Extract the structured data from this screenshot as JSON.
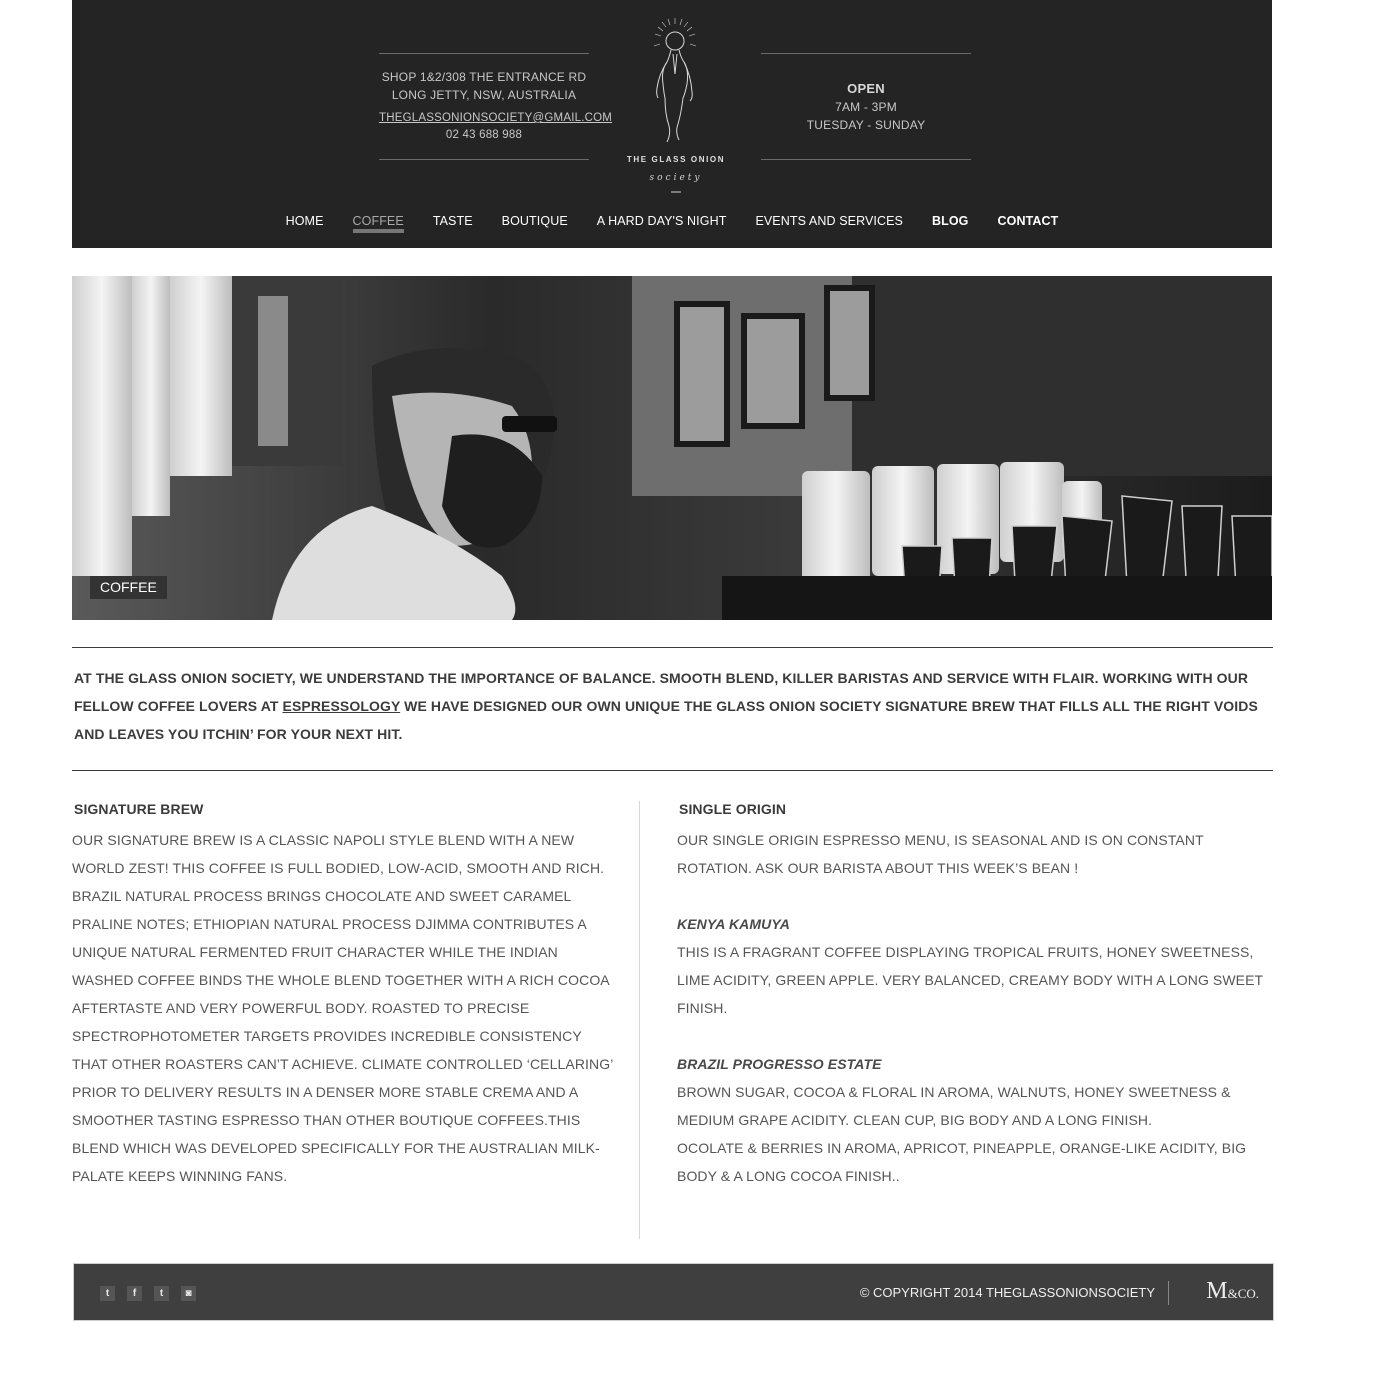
{
  "header": {
    "address_line1": "SHOP 1&2/308 THE ENTRANCE RD",
    "address_line2": "LONG JETTY, NSW, AUSTRALIA",
    "email": "THEGLASSONIONSOCIETY@GMAIL.COM",
    "phone": "02 43 688 988",
    "hours_title": "OPEN",
    "hours_time": "7AM - 3PM",
    "hours_days": "TUESDAY - SUNDAY",
    "logo_line1": "THE GLASS ONION",
    "logo_line2": "society"
  },
  "nav": {
    "items": [
      {
        "label": "HOME"
      },
      {
        "label": "COFFEE"
      },
      {
        "label": "TASTE"
      },
      {
        "label": "BOUTIQUE"
      },
      {
        "label": "A HARD DAY'S NIGHT"
      },
      {
        "label": "EVENTS AND SERVICES"
      },
      {
        "label": "BLOG"
      },
      {
        "label": "CONTACT"
      }
    ],
    "active": "COFFEE"
  },
  "hero": {
    "label": "COFFEE"
  },
  "intro": {
    "text_before": "AT THE GLASS ONION SOCIETY, WE UNDERSTAND THE IMPORTANCE OF BALANCE. SMOOTH BLEND, KILLER BARISTAS AND SERVICE WITH FLAIR. WORKING WITH OUR FELLOW COFFEE LOVERS AT ",
    "link": "ESPRESSOLOGY",
    "text_after": " WE HAVE DESIGNED OUR OWN UNIQUE THE GLASS ONION SOCIETY SIGNATURE BREW THAT FILLS ALL THE RIGHT VOIDS AND LEAVES YOU ITCHIN’ FOR YOUR NEXT HIT."
  },
  "signature": {
    "title": "SIGNATURE BREW",
    "body": "OUR SIGNATURE BREW IS A CLASSIC NAPOLI STYLE BLEND WITH A NEW WORLD ZEST! THIS COFFEE IS FULL BODIED, LOW-ACID, SMOOTH AND RICH. BRAZIL NATURAL PROCESS BRINGS CHOCOLATE AND SWEET CARAMEL PRALINE NOTES; ETHIOPIAN NATURAL PROCESS DJIMMA CONTRIBUTES A UNIQUE NATURAL FERMENTED FRUIT CHARACTER WHILE THE INDIAN WASHED COFFEE BINDS THE WHOLE BLEND TOGETHER WITH A RICH COCOA AFTERTASTE AND VERY POWERFUL BODY. ROASTED TO PRECISE SPECTROPHOTOMETER TARGETS PROVIDES INCREDIBLE CONSISTENCY THAT OTHER ROASTERS CAN’T ACHIEVE. CLIMATE CONTROLLED ‘CELLARING’ PRIOR TO DELIVERY RESULTS IN A DENSER MORE STABLE CREMA AND A SMOOTHER TASTING ESPRESSO THAN OTHER BOUTIQUE COFFEES.THIS BLEND WHICH WAS DEVELOPED SPECIFICALLY FOR THE AUSTRALIAN MILK-PALATE KEEPS WINNING FANS."
  },
  "single_origin": {
    "title": "SINGLE ORIGIN",
    "intro": "OUR SINGLE ORIGIN ESPRESSO MENU, IS SEASONAL AND IS ON CONSTANT ROTATION. ASK OUR BARISTA ABOUT THIS WEEK’S BEAN !",
    "kenya_title": "KENYA KAMUYA",
    "kenya_body": "THIS IS A FRAGRANT COFFEE DISPLAYING TROPICAL FRUITS, HONEY SWEETNESS, LIME ACIDITY, GREEN APPLE. VERY BALANCED, CREAMY BODY WITH A LONG SWEET FINISH.",
    "brazil_title": "BRAZIL PROGRESSO ESTATE",
    "brazil_body1": "BROWN SUGAR, COCOA & FLORAL IN AROMA, WALNUTS, HONEY SWEETNESS & MEDIUM GRAPE ACIDITY. CLEAN CUP, BIG BODY AND A LONG FINISH.",
    "brazil_body2": "OCOLATE & BERRIES IN AROMA, APRICOT, PINEAPPLE, ORANGE-LIKE ACIDITY, BIG BODY & A LONG COCOA FINISH.."
  },
  "footer": {
    "social": [
      {
        "icon": "twitter-icon",
        "glyph": "t"
      },
      {
        "icon": "facebook-icon",
        "glyph": "f"
      },
      {
        "icon": "tumblr-icon",
        "glyph": "t"
      },
      {
        "icon": "instagram-icon",
        "glyph": "◙"
      }
    ],
    "copyright": "© COPYRIGHT 2014 THEGLASSONIONSOCIETY",
    "brand_main": "M",
    "brand_small": "&CO."
  }
}
